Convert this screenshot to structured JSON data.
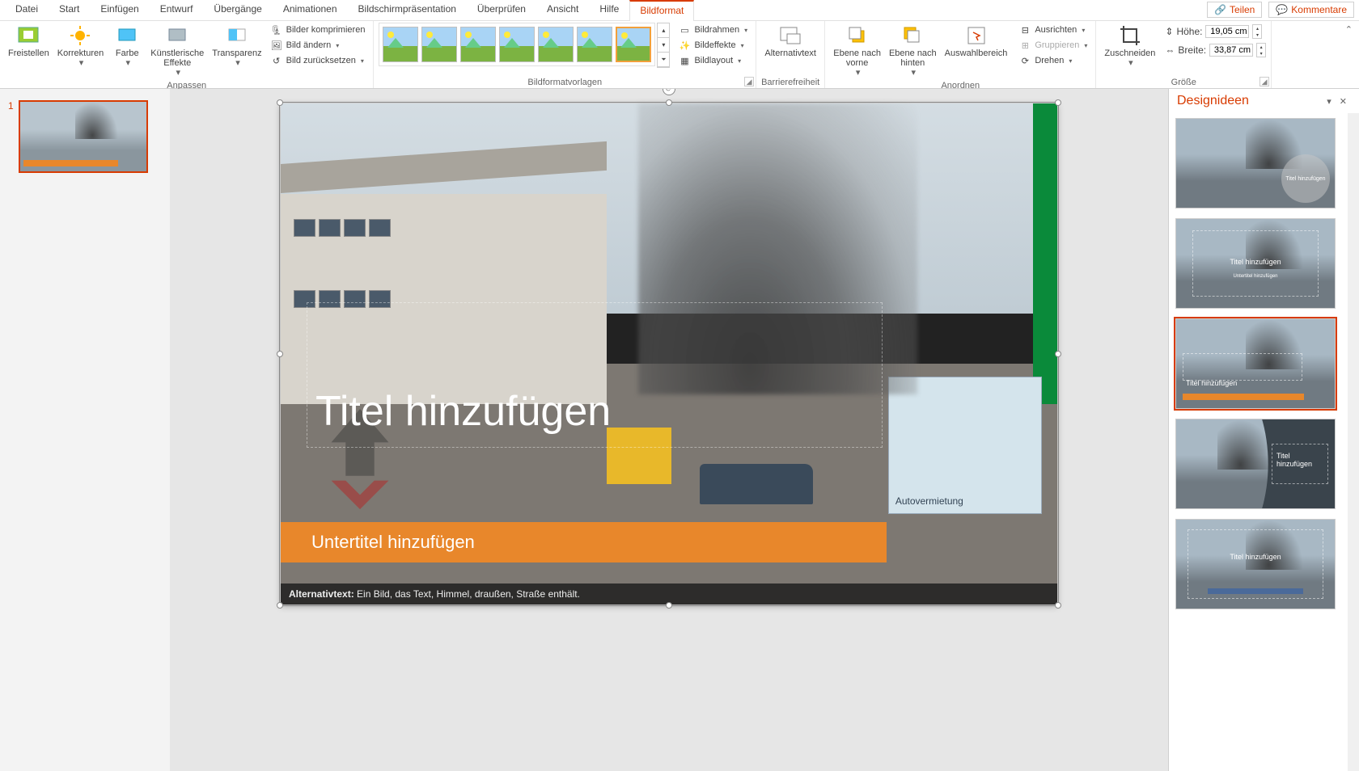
{
  "menu": {
    "tabs": [
      "Datei",
      "Start",
      "Einfügen",
      "Entwurf",
      "Übergänge",
      "Animationen",
      "Bildschirmpräsentation",
      "Überprüfen",
      "Ansicht",
      "Hilfe",
      "Bildformat"
    ],
    "active": "Bildformat",
    "share": "Teilen",
    "comments": "Kommentare"
  },
  "ribbon": {
    "adjust": {
      "label": "Anpassen",
      "remove_bg": "Freistellen",
      "corrections": "Korrekturen",
      "color": "Farbe",
      "artistic": "Künstlerische\nEffekte",
      "transparency": "Transparenz",
      "compress": "Bilder komprimieren",
      "change": "Bild ändern",
      "reset": "Bild zurücksetzen"
    },
    "styles": {
      "label": "Bildformatvorlagen",
      "border": "Bildrahmen",
      "effects": "Bildeffekte",
      "layout": "Bildlayout"
    },
    "accessibility": {
      "label": "Barrierefreiheit",
      "alttext": "Alternativtext"
    },
    "arrange": {
      "label": "Anordnen",
      "forward": "Ebene nach\nvorne",
      "backward": "Ebene nach\nhinten",
      "selection": "Auswahlbereich",
      "align": "Ausrichten",
      "group": "Gruppieren",
      "rotate": "Drehen"
    },
    "size": {
      "label": "Größe",
      "crop": "Zuschneiden",
      "height_lbl": "Höhe:",
      "width_lbl": "Breite:",
      "height": "19,05 cm",
      "width": "33,87 cm"
    }
  },
  "slides": {
    "num1": "1"
  },
  "slide": {
    "title": "Titel hinzufügen",
    "subtitle": "Untertitel hinzufügen",
    "alt_label": "Alternativtext:",
    "alt_text": "Ein Bild, das Text, Himmel, draußen, Straße enthält.",
    "sign1": "Autovermietung"
  },
  "design": {
    "title": "Designideen",
    "idea_title": "Titel hinzufügen",
    "idea_sub": "Untertitel hinzufügen"
  }
}
